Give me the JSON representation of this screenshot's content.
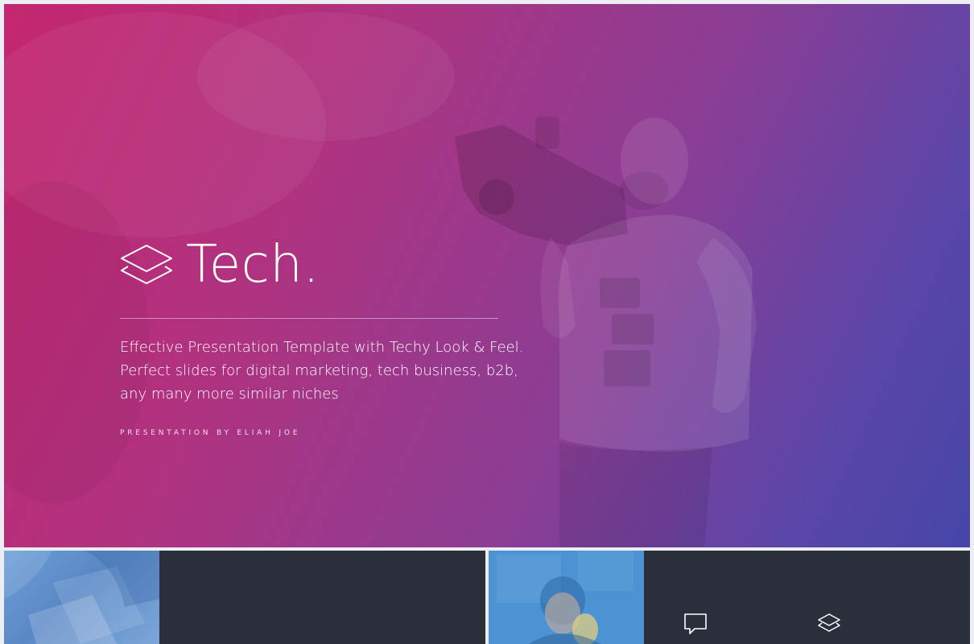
{
  "hero": {
    "title": "Tech.",
    "description_lines": [
      "Effective Presentation Template with Techy Look & Feel.",
      "Perfect slides for digital marketing, tech business, b2b,",
      "any many more similar niches"
    ],
    "byline": "PRESENTATION BY  ELIAH JOE",
    "logo_icon": "layers-icon"
  },
  "thumbnails": [
    {
      "photo": "money-hands-photo",
      "icons": []
    },
    {
      "photo": "person-photo",
      "icons": [
        "speech-bubble-icon",
        "layers-icon"
      ]
    }
  ],
  "colors": {
    "gradient_start": "#c4276f",
    "gradient_mid": "#8a3e95",
    "gradient_end": "#4546a8",
    "thumb_panel": "#2b2e3b"
  }
}
